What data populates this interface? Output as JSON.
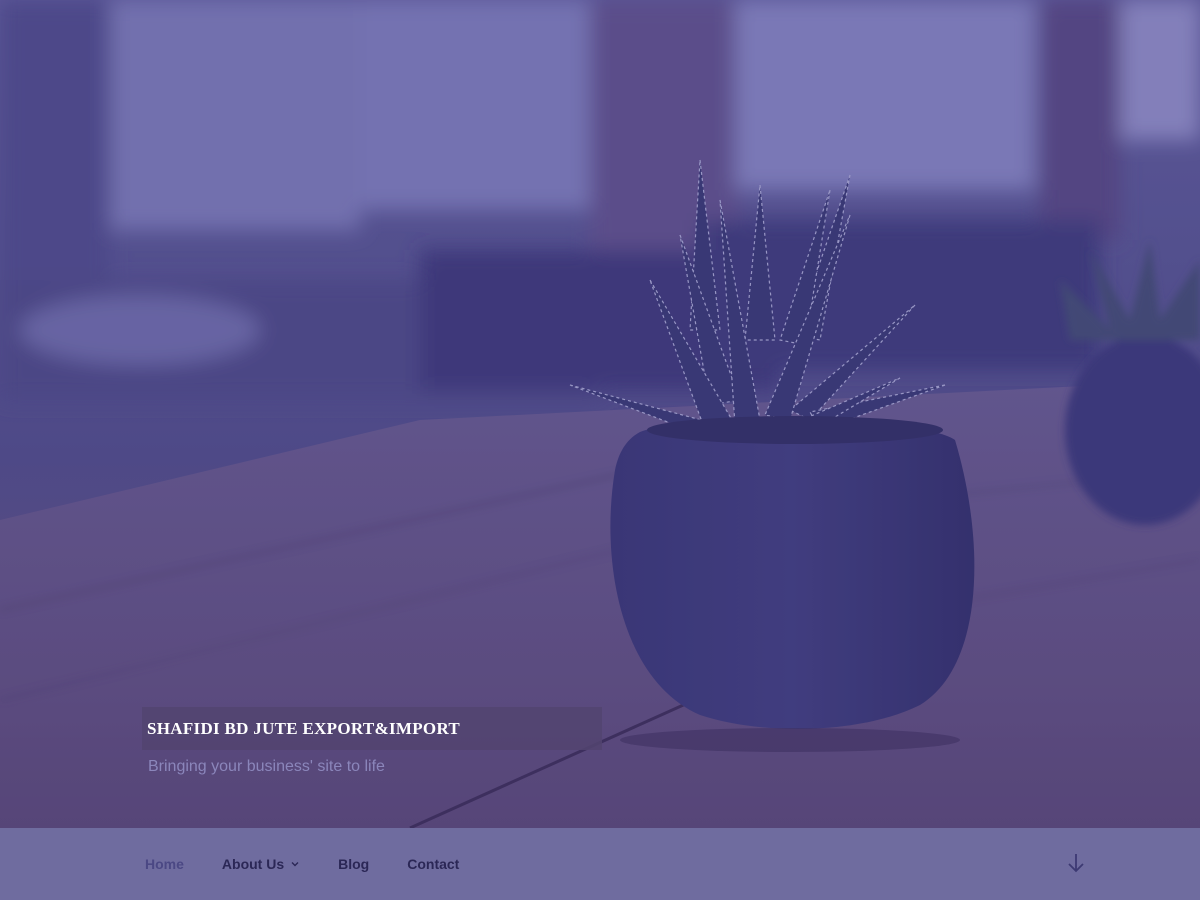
{
  "site": {
    "title": "SHAFIDI BD JUTE EXPORT&IMPORT",
    "tagline": "Bringing your business' site to life"
  },
  "navigation": {
    "items": [
      {
        "label": "Home",
        "current": true,
        "has_submenu": false
      },
      {
        "label": "About Us",
        "current": false,
        "has_submenu": true
      },
      {
        "label": "Blog",
        "current": false,
        "has_submenu": false
      },
      {
        "label": "Contact",
        "current": false,
        "has_submenu": false
      }
    ],
    "submenu_icon": "chevron-down-icon",
    "scroll_icon": "arrow-down-icon"
  },
  "hero": {
    "image_subject": "potted succulent on wooden table"
  },
  "colors": {
    "nav_background": "#6f6c9f",
    "nav_text": "#2b2756",
    "title_text": "#ffffff",
    "tagline_text": "#8b86bb"
  }
}
